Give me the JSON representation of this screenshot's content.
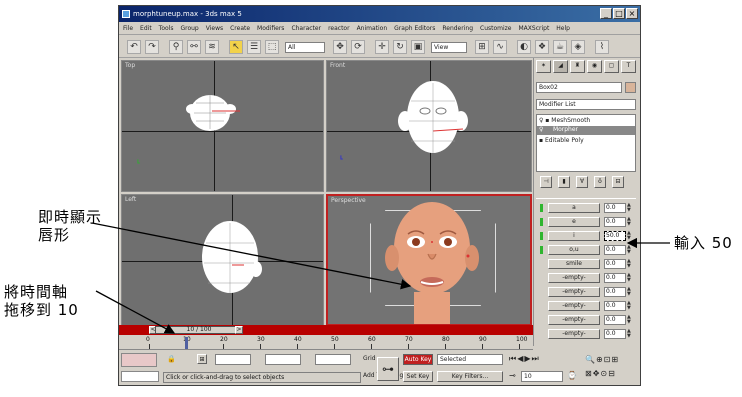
{
  "window": {
    "title": "morphtuneup.max - 3ds max 5"
  },
  "menu": [
    "File",
    "Edit",
    "Tools",
    "Group",
    "Views",
    "Create",
    "Modifiers",
    "Character",
    "reactor",
    "Animation",
    "Graph Editors",
    "Rendering",
    "Customize",
    "MAXScript",
    "Help"
  ],
  "toolbar": {
    "select_filter": "All",
    "view_dropdown": "View"
  },
  "viewports": {
    "top": "Top",
    "front": "Front",
    "left": "Left",
    "perspective": "Perspective"
  },
  "command_panel": {
    "object_name": "Box02",
    "modifier_list": "Modifier List",
    "stack": [
      "MeshSmooth",
      "Morpher",
      "Editable Poly"
    ],
    "channels": [
      {
        "name": "a",
        "value": "0.0"
      },
      {
        "name": "e",
        "value": "0.0"
      },
      {
        "name": "i",
        "value": "50.0"
      },
      {
        "name": "o,u",
        "value": "0.0"
      },
      {
        "name": "smile",
        "value": "0.0"
      },
      {
        "name": "-empty-",
        "value": "0.0"
      },
      {
        "name": "-empty-",
        "value": "0.0"
      },
      {
        "name": "-empty-",
        "value": "0.0"
      },
      {
        "name": "-empty-",
        "value": "0.0"
      },
      {
        "name": "-empty-",
        "value": "0.0"
      }
    ]
  },
  "timeline": {
    "slider_label": "10 / 100",
    "ticks": [
      "0",
      "10",
      "20",
      "30",
      "40",
      "50",
      "60",
      "70",
      "80",
      "90",
      "100"
    ]
  },
  "status": {
    "prompt": "Click or click-and-drag to select objects",
    "auto_key": "Auto Key",
    "set_key": "Set Key",
    "key_filters": "Key Filters...",
    "selected": "Selected",
    "frame": "10",
    "grid": "Grid",
    "add_time_tag": "Add Time Tag"
  },
  "annotations": {
    "lip_line1": "即時顯示",
    "lip_line2": "唇形",
    "input": "輸入 50",
    "time_line1": "將時間軸",
    "time_line2": "拖移到 10"
  }
}
